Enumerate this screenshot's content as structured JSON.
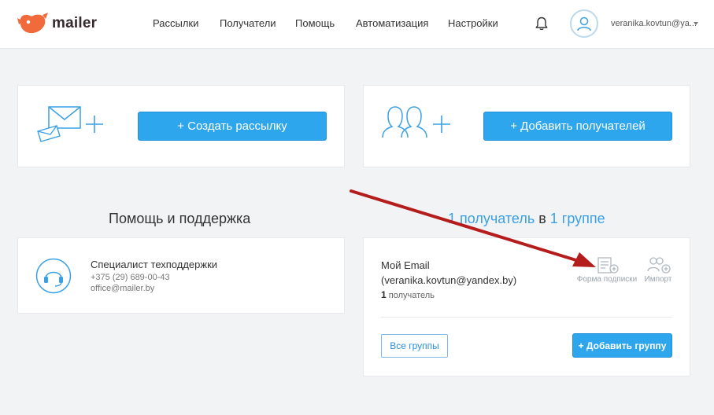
{
  "header": {
    "logo_text": "mailer",
    "nav": [
      "Рассылки",
      "Получатели",
      "Помощь",
      "Автоматизация",
      "Настройки"
    ],
    "user_email": "veranika.kovtun@ya..."
  },
  "cards": {
    "create_campaign_label": "+ Создать рассылку",
    "add_recipients_label": "+ Добавить получателей"
  },
  "support": {
    "title": "Помощь и поддержка",
    "name": "Специалист техподдержки",
    "phone": "+375 (29) 689-00-43",
    "email": "office@mailer.by"
  },
  "stats": {
    "recipients_link": "1 получатель",
    "connector": " в ",
    "groups_link": "1 группе"
  },
  "group": {
    "name_line1": "Мой Email",
    "name_line2": "(veranika.kovtun@yandex.by)",
    "count": "1",
    "count_label": "получатель",
    "form_label": "Форма подписки",
    "import_label": "Импорт",
    "all_groups_label": "Все группы",
    "add_group_label": "+ Добавить группу"
  },
  "colors": {
    "accent": "#2ea6ee",
    "link": "#3aa0e6",
    "annotation_arrow": "#b51d1d",
    "logo": "#f06a3b"
  }
}
